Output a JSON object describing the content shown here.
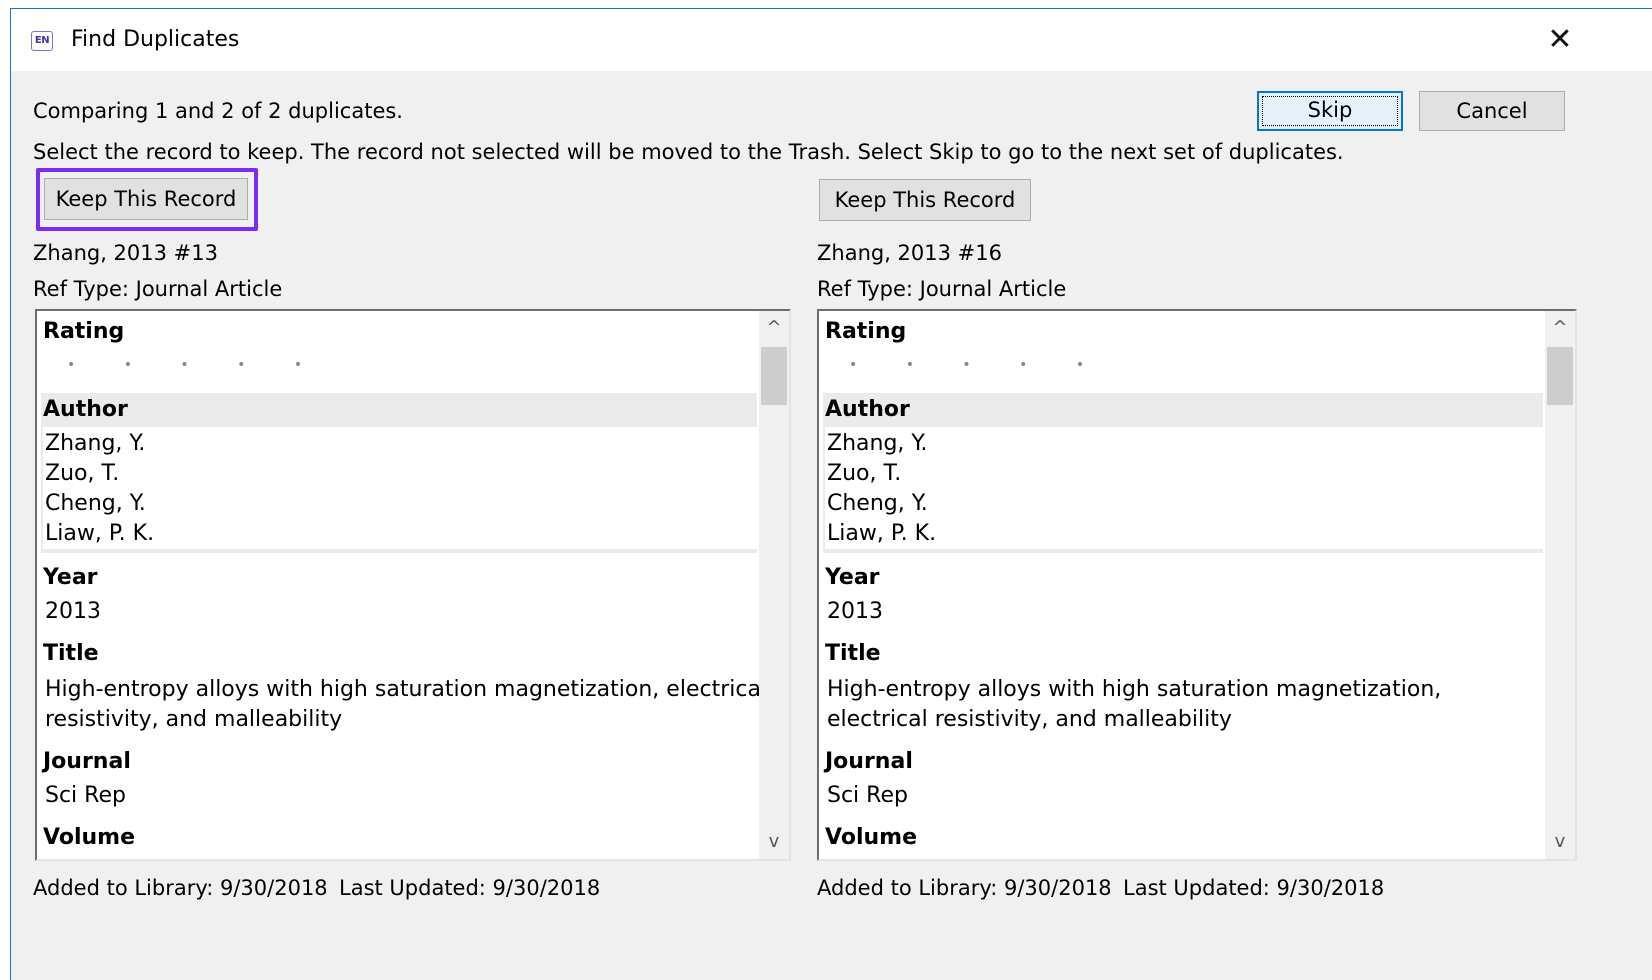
{
  "window": {
    "title": "Find Duplicates",
    "icon_text": "EN",
    "close_glyph": "✕"
  },
  "header": {
    "comparing_text": "Comparing 1 and 2 of 2 duplicates.",
    "instruction_text": "Select the record to keep. The record not selected will be moved to the Trash. Select Skip to go to the next set of duplicates.",
    "skip_label": "Skip",
    "cancel_label": "Cancel"
  },
  "records": [
    {
      "keep_label": "Keep This Record",
      "ref_id": "Zhang, 2013 #13",
      "ref_type": "Ref Type: Journal Article",
      "fields": {
        "rating_label": "Rating",
        "rating_stars": "• • • • •",
        "author_label": "Author",
        "authors": [
          "Zhang, Y.",
          "Zuo, T.",
          "Cheng, Y.",
          "Liaw, P. K."
        ],
        "year_label": "Year",
        "year": "2013",
        "title_label": "Title",
        "title_lines": [
          "High-entropy alloys with high saturation magnetization, electrical",
          "resistivity, and malleability"
        ],
        "journal_label": "Journal",
        "journal": "Sci Rep",
        "volume_label": "Volume"
      },
      "added": "Added to Library: 9/30/2018",
      "updated": "Last Updated: 9/30/2018"
    },
    {
      "keep_label": "Keep This Record",
      "ref_id": "Zhang, 2013 #16",
      "ref_type": "Ref Type: Journal Article",
      "fields": {
        "rating_label": "Rating",
        "rating_stars": "• • • • •",
        "author_label": "Author",
        "authors": [
          "Zhang, Y.",
          "Zuo, T.",
          "Cheng, Y.",
          "Liaw, P. K."
        ],
        "year_label": "Year",
        "year": "2013",
        "title_label": "Title",
        "title_lines": [
          "High-entropy alloys with high saturation magnetization,",
          "electrical resistivity, and malleability"
        ],
        "journal_label": "Journal",
        "journal": "Sci Rep",
        "volume_label": "Volume"
      },
      "added": "Added to Library: 9/30/2018",
      "updated": "Last Updated: 9/30/2018"
    }
  ],
  "scrollbar": {
    "up_glyph": "^",
    "down_glyph": "v"
  },
  "colors": {
    "highlight": "#7b2cf4",
    "focus_border": "#0078d7",
    "window_border": "#1a78c2"
  }
}
